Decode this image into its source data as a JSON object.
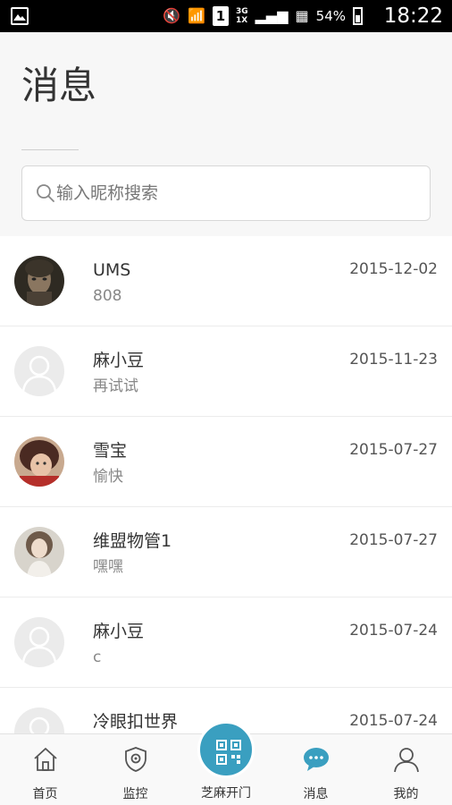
{
  "status_bar": {
    "network_label_top": "3G",
    "network_label_bottom": "1X",
    "sim_label": "1",
    "battery_percent": "54%",
    "battery_level": 0.54,
    "time": "18:22"
  },
  "header": {
    "title": "消息"
  },
  "search": {
    "placeholder": "输入昵称搜索",
    "value": ""
  },
  "messages": [
    {
      "name": "UMS",
      "preview": "808",
      "date": "2015-12-02",
      "avatar": "photo-dark-portrait"
    },
    {
      "name": "麻小豆",
      "preview": "再试试",
      "date": "2015-11-23",
      "avatar": "default-user-icon"
    },
    {
      "name": "雪宝",
      "preview": "愉快",
      "date": "2015-07-27",
      "avatar": "photo-child-red"
    },
    {
      "name": "维盟物管1",
      "preview": "嘿嘿",
      "date": "2015-07-27",
      "avatar": "photo-woman-light"
    },
    {
      "name": "麻小豆",
      "preview": "c",
      "date": "2015-07-24",
      "avatar": "default-user-icon"
    },
    {
      "name": "冷眼扣世界",
      "preview": "",
      "date": "2015-07-24",
      "avatar": "default-user-icon"
    }
  ],
  "tabs": [
    {
      "label": "首页",
      "icon": "home-icon",
      "active": false
    },
    {
      "label": "监控",
      "icon": "shield-icon",
      "active": false
    },
    {
      "label": "芝麻开门",
      "icon": "qrcode-icon",
      "active": false
    },
    {
      "label": "消息",
      "icon": "chat-bubble-icon",
      "active": true
    },
    {
      "label": "我的",
      "icon": "user-icon",
      "active": false
    }
  ],
  "colors": {
    "accent": "#3a9fc0",
    "background": "#f7f7f7",
    "text_primary": "#333333",
    "text_secondary": "#888888"
  }
}
